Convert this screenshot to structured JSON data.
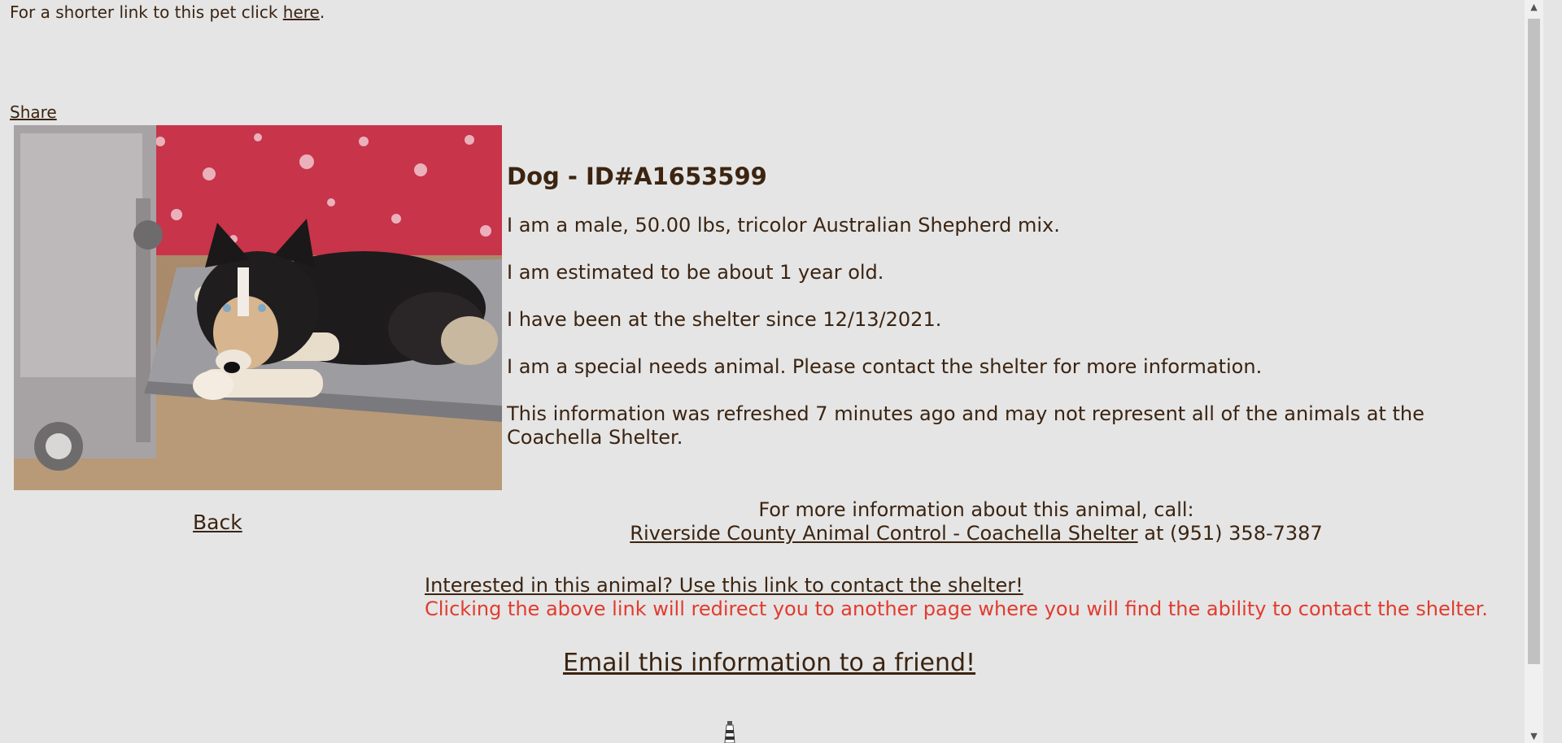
{
  "shortlink": {
    "prefix": "For a shorter link to this pet click ",
    "link": "here",
    "suffix": "."
  },
  "share": "Share",
  "animal": {
    "title": "Dog - ID#A1653599",
    "facts": [
      "I am a male, 50.00 lbs, tricolor Australian Shepherd mix.",
      "I am estimated to be about 1 year old.",
      "I have been at the shelter since 12/13/2021.",
      "I am a special needs animal. Please contact the shelter for more information.",
      "This information was refreshed 7 minutes ago and may not represent all of the animals at the Coachella Shelter."
    ]
  },
  "back": "Back",
  "contact": {
    "call_text": "For more information about this animal, call:",
    "shelter_link": "Riverside County Animal Control - Coachella Shelter",
    "phone_text": " at (951) 358-7387"
  },
  "interested": {
    "link": "Interested in this animal? Use this link to contact the shelter!",
    "note": "Clicking the above link will redirect you to another page where you will find the ability to contact the shelter."
  },
  "email": "Email this information to a friend!",
  "icons": {
    "photo": "dog-photo",
    "lighthouse": "lighthouse-icon",
    "scroll_up": "scroll-up-arrow-icon",
    "scroll_down": "scroll-down-arrow-icon"
  },
  "colors": {
    "background": "#e5e5e5",
    "text": "#3b2411",
    "note": "#e23b2e"
  }
}
